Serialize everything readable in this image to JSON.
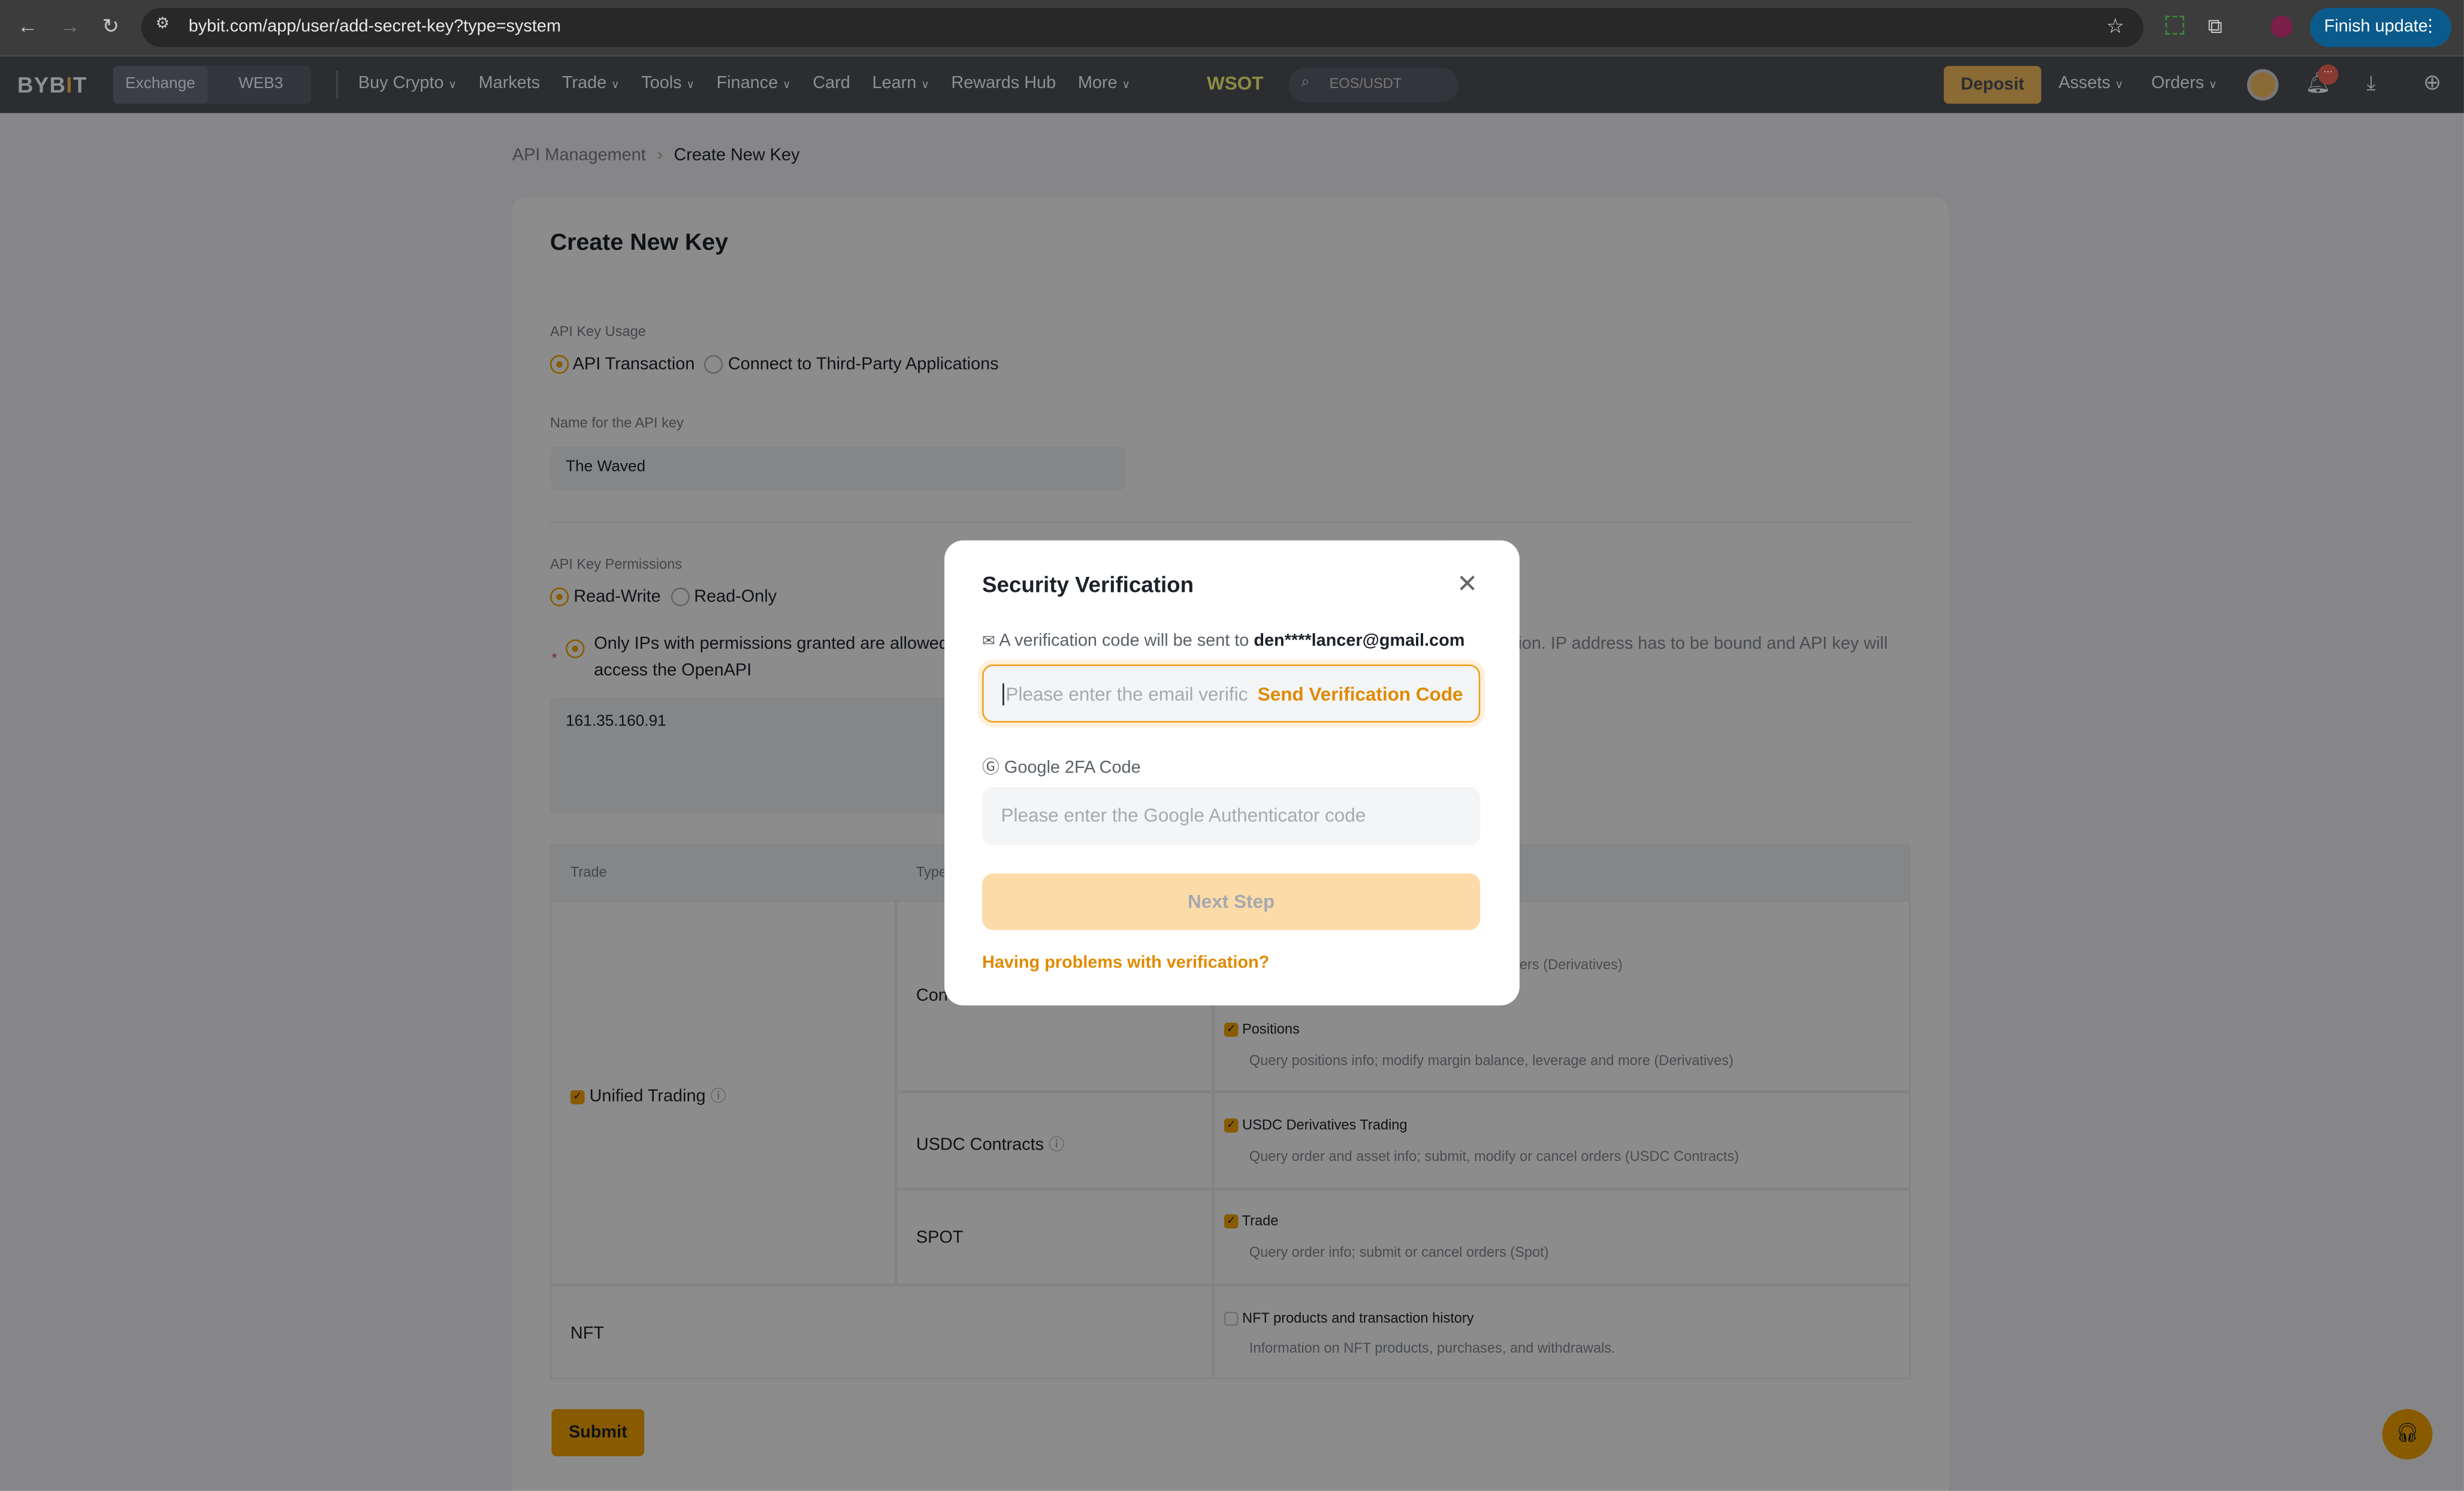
{
  "browser": {
    "url": "bybit.com/app/user/add-secret-key?type=system",
    "finish_update": "Finish update"
  },
  "nav": {
    "logo": "BYBIT",
    "tabs": [
      "Exchange",
      "WEB3"
    ],
    "items": [
      "Buy Crypto",
      "Markets",
      "Trade",
      "Tools",
      "Finance",
      "Card",
      "Learn",
      "Rewards Hub",
      "More"
    ],
    "dropdown_items": [
      true,
      false,
      true,
      true,
      true,
      false,
      true,
      false,
      true
    ],
    "promo": "WSOT",
    "search_placeholder": "EOS/USDT",
    "deposit": "Deposit",
    "assets": "Assets",
    "orders": "Orders",
    "notification_badge": "..."
  },
  "breadcrumb": {
    "parent": "API Management",
    "current": "Create New Key"
  },
  "form": {
    "title": "Create New Key",
    "usage_label": "API Key Usage",
    "usage_options": [
      "API Transaction",
      "Connect to Third-Party Applications"
    ],
    "usage_selected": "API Transaction",
    "name_label": "Name for the API key",
    "name_value": "The Waved",
    "permissions_label": "API Key Permissions",
    "permission_options": [
      "Read-Write",
      "Read-Only"
    ],
    "permission_selected": "Read-Write",
    "ip_text_left": "Only IPs with permissions granted are allowed",
    "ip_text_right": "tion. IP address has to be bound and API key will",
    "ip_text_line2": "access the OpenAPI",
    "ip_value": "161.35.160.91",
    "table": {
      "headers": [
        "Trade",
        "Type"
      ],
      "unified": "Unified Trading",
      "contract_type": "Con",
      "contract_perm1_desc": "orders (Derivatives)",
      "positions": "Positions",
      "positions_desc": "Query positions info; modify margin balance, leverage and more (Derivatives)",
      "usdc_type": "USDC Contracts",
      "usdc_perm": "USDC Derivatives Trading",
      "usdc_desc": "Query order and asset info; submit, modify or cancel orders (USDC Contracts)",
      "spot_type": "SPOT",
      "spot_perm": "Trade",
      "spot_desc": "Query order info; submit or cancel orders (Spot)",
      "nft": "NFT",
      "nft_perm": "NFT products and transaction history",
      "nft_desc": "Information on NFT products, purchases, and withdrawals."
    },
    "submit": "Submit"
  },
  "modal": {
    "title": "Security Verification",
    "info_prefix": "A verification code will be sent to",
    "email": "den****lancer@gmail.com",
    "email_placeholder": "Please enter the email verific",
    "send_code": "Send Verification Code",
    "google_label": "Google 2FA Code",
    "google_placeholder": "Please enter the Google Authenticator code",
    "next": "Next Step",
    "help_link": "Having problems with verification?"
  },
  "colors": {
    "accent": "#f7a600",
    "link": "#e08a00",
    "next_disabled": "#fcdba8"
  }
}
